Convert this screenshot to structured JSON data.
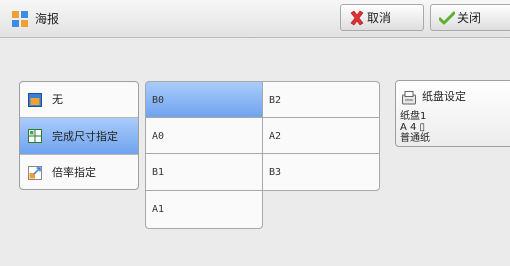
{
  "window": {
    "title": "海报"
  },
  "toolbar": {
    "cancel_label": "取消",
    "close_label": "关闭"
  },
  "mode_options": [
    {
      "label": "无",
      "selected": false
    },
    {
      "label": "完成尺寸指定",
      "selected": true
    },
    {
      "label": "倍率指定",
      "selected": false
    }
  ],
  "sizes": {
    "col1": [
      {
        "label": "B0",
        "selected": true
      },
      {
        "label": "A0",
        "selected": false
      },
      {
        "label": "B1",
        "selected": false
      },
      {
        "label": "A1",
        "selected": false
      }
    ],
    "col2": [
      {
        "label": "B2",
        "selected": false
      },
      {
        "label": "A2",
        "selected": false
      },
      {
        "label": "B3",
        "selected": false
      }
    ]
  },
  "tray": {
    "heading": "纸盘设定",
    "line1": "纸盘1",
    "line2": "A 4 ▯",
    "line3": "普通纸"
  },
  "colors": {
    "selected_top": "#a9ccfa",
    "selected_bottom": "#6fa3ef",
    "cancel_x": "#e53030",
    "close_check": "#5fb02e"
  }
}
